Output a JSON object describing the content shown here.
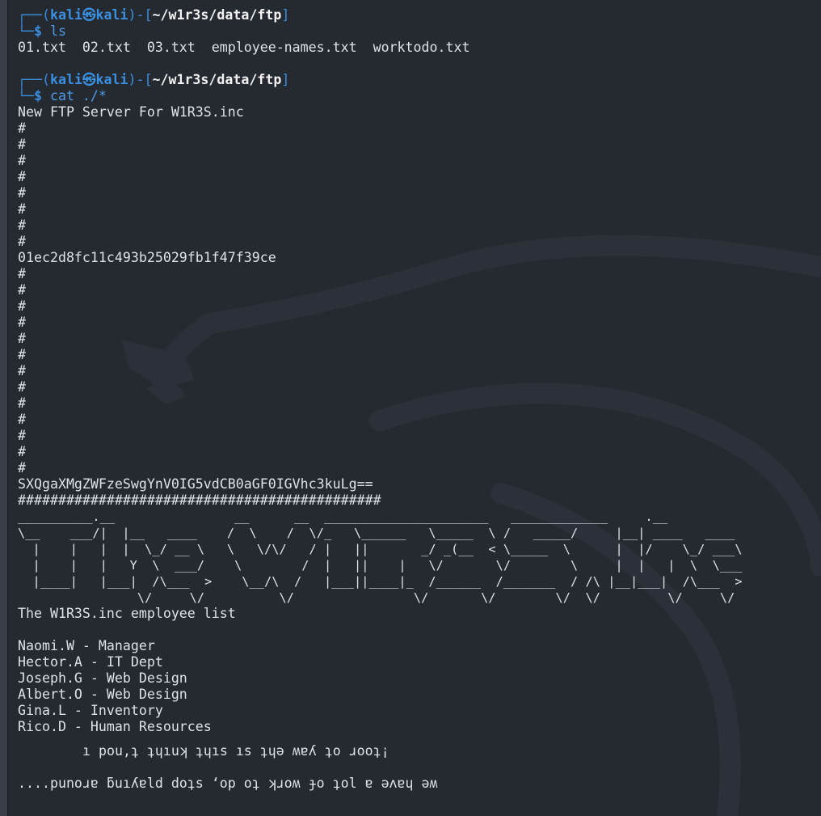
{
  "colors": {
    "background": "#252930",
    "prompt_blue": "#3a8fe0",
    "text": "#dfe3e8"
  },
  "terminal": {
    "prompt_user": "kali",
    "prompt_skull": "㉿",
    "prompt_host": "kali",
    "prompt_path": "~/w1r3s/data/ftp",
    "cmd1": "ls",
    "ls_output": "01.txt  02.txt  03.txt  employee-names.txt  worktodo.txt",
    "cmd2": "cat ./*",
    "ftp_title": "New FTP Server For W1R3S.inc",
    "hash": "01ec2d8fc11c493b25029fb1f47f39ce",
    "b64": "SXQgaXMgZWFzeSwgYnV0IG5vdCB0aGF0IGVhc3kuLg==",
    "hash_line": "#############################################",
    "ascii_art": [
      "__________.__                __      __  ______________________   _____________     .__",
      "\\__    ___/|  |__   ____    /  \\    /  \\/_   \\______   \\_____  \\ /   _____/     |__| ____   ____",
      "  |    |   |  |  \\_/ __ \\   \\   \\/\\/   / |   ||       _/ _(__  < \\_____  \\      |  |/    \\_/ ___\\",
      "  |    |   |   Y  \\  ___/    \\        /  |   ||    |   \\/       \\/        \\     |  |   |  \\  \\___",
      "  |____|   |___|  /\\___  >    \\__/\\  /   |___||____|_  /______  /_______  / /\\ |__|___|  /\\___  >",
      "                \\/     \\/          \\/                \\/       \\/        \\/  \\/         \\/     \\/"
    ],
    "employee_title": "The W1R3S.inc employee list",
    "employees": [
      "Naomi.W - Manager",
      "Hector.A - IT Dept",
      "Joseph.G - Web Design",
      "Albert.O - Web Design",
      "Gina.L - Inventory",
      "Rico.D - Human Resources"
    ],
    "todo1": "ı pou,ʇ ʇɥıuʞ ʇɥıs ıs ʇɥǝ ʍɐʎ ʇo ɹooʇ¡",
    "todo2": "....punoɹɐ ƃuıʎɐld doʇs ‘op oʇ ʞɹoʍ ɟo ʇol ɐ ǝʌɐɥ ǝʍ"
  }
}
